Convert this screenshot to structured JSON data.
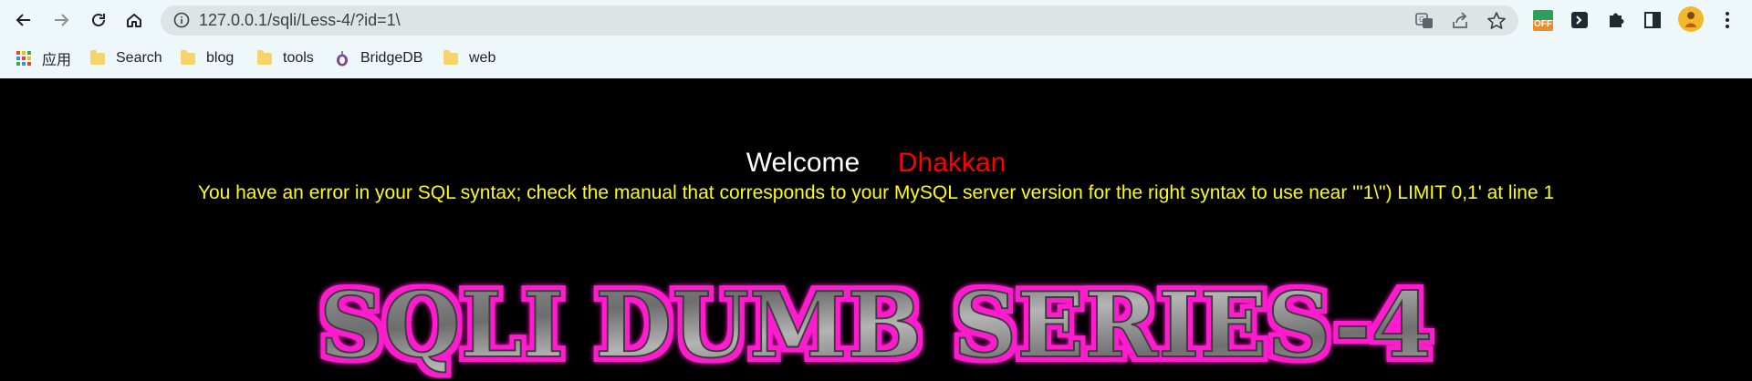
{
  "browser": {
    "url": "127.0.0.1/sqli/Less-4/?id=1\\",
    "ext_badge": "OFF",
    "nav_icons": [
      "back-arrow-icon",
      "forward-arrow-icon",
      "reload-icon",
      "home-icon"
    ],
    "omnibox_icons": [
      "info-icon",
      "translate-icon",
      "share-icon",
      "star-icon"
    ],
    "extension_icons": [
      "extension-off-icon",
      "terminal-extension-icon",
      "puzzle-icon",
      "sidepanel-icon",
      "avatar",
      "menu-icon"
    ]
  },
  "bookmarks": [
    {
      "label": "应用",
      "icon": "apps-grid-icon"
    },
    {
      "label": "Search",
      "icon": "folder-icon"
    },
    {
      "label": "blog",
      "icon": "folder-icon"
    },
    {
      "label": "tools",
      "icon": "folder-icon"
    },
    {
      "label": "BridgeDB",
      "icon": "onion-icon"
    },
    {
      "label": "web",
      "icon": "folder-icon"
    }
  ],
  "page": {
    "welcome": "Welcome",
    "name": "Dhakkan",
    "error": "You have an error in your SQL syntax; check the manual that corresponds to your MySQL server version for the right syntax to use near '\"1\\\") LIMIT 0,1' at line 1",
    "banner": "SQLI DUMB SERIES-4"
  },
  "colors": {
    "error_text": "#ffff00",
    "name_text": "#ff0000",
    "banner_glow": "#ff1ecf"
  }
}
